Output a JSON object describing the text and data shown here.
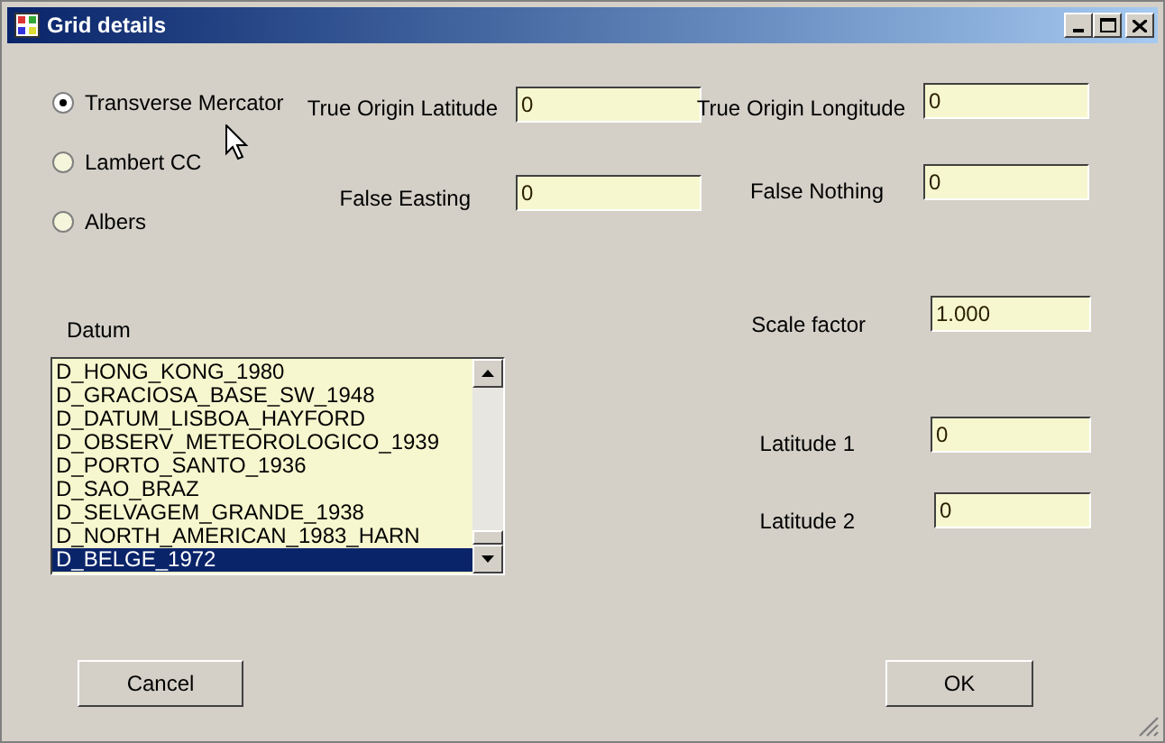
{
  "window": {
    "title": "Grid details"
  },
  "projections": [
    {
      "label": "Transverse Mercator",
      "selected": true
    },
    {
      "label": "Lambert CC",
      "selected": false
    },
    {
      "label": "Albers",
      "selected": false
    }
  ],
  "fields": [
    {
      "label": "True Origin Latitude",
      "value": "0"
    },
    {
      "label": "True Origin Longitude",
      "value": "0"
    },
    {
      "label": "False Easting",
      "value": "0"
    },
    {
      "label": "False Nothing",
      "value": "0"
    },
    {
      "label": "Scale factor",
      "value": "1.000"
    },
    {
      "label": "Latitude 1",
      "value": "0"
    },
    {
      "label": "Latitude 2",
      "value": "0"
    }
  ],
  "datum": {
    "label": "Datum",
    "items": [
      {
        "text": "D_HONG_KONG_1980",
        "selected": false
      },
      {
        "text": "D_GRACIOSA_BASE_SW_1948",
        "selected": false
      },
      {
        "text": "D_DATUM_LISBOA_HAYFORD",
        "selected": false
      },
      {
        "text": "D_OBSERV_METEOROLOGICO_1939",
        "selected": false
      },
      {
        "text": "D_PORTO_SANTO_1936",
        "selected": false
      },
      {
        "text": "D_SAO_BRAZ",
        "selected": false
      },
      {
        "text": "D_SELVAGEM_GRANDE_1938",
        "selected": false
      },
      {
        "text": "D_NORTH_AMERICAN_1983_HARN",
        "selected": false
      },
      {
        "text": "D_BELGE_1972",
        "selected": true
      }
    ]
  },
  "buttons": [
    "Cancel",
    "OK"
  ]
}
